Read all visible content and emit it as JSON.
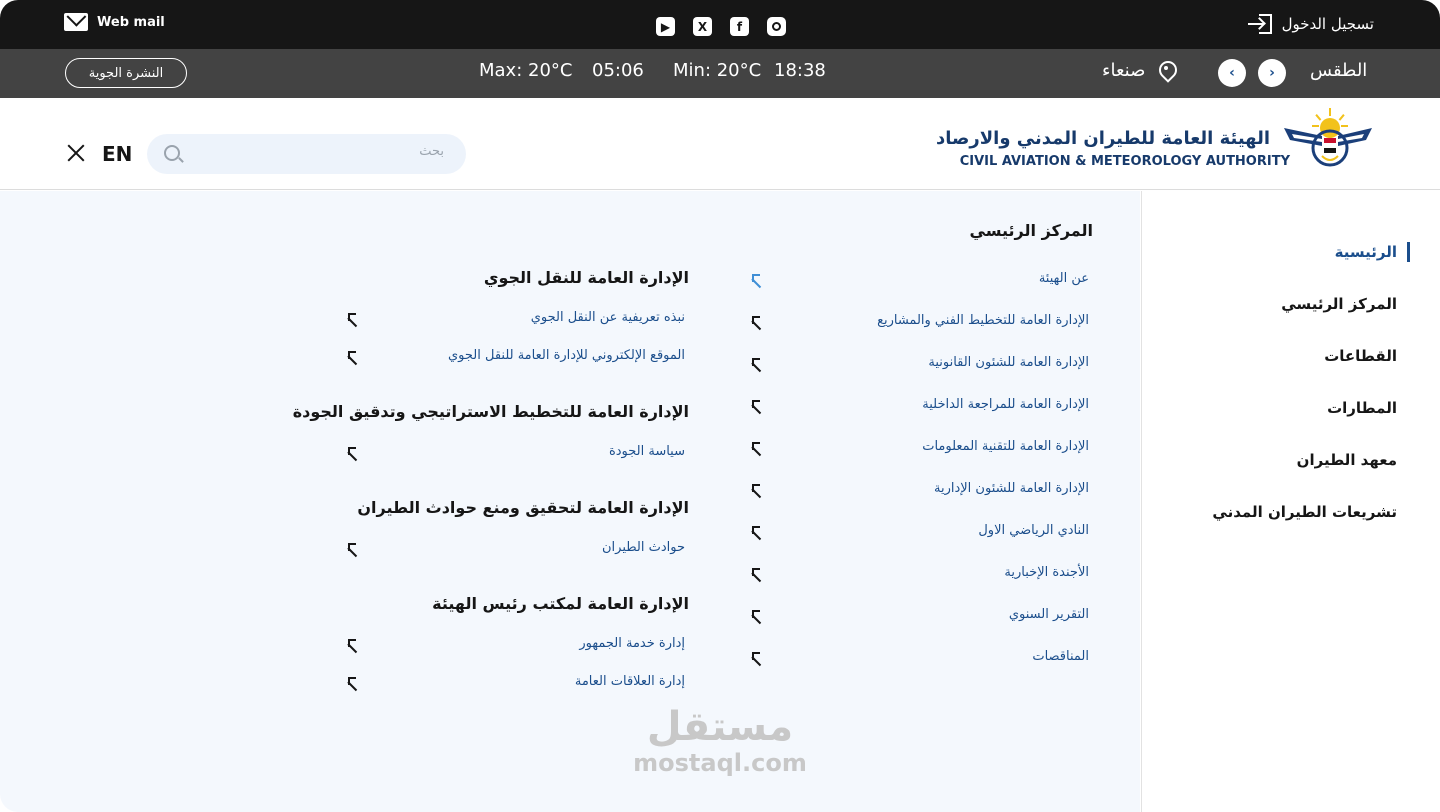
{
  "topbar": {
    "webmail_label": "Web mail",
    "socials": [
      "youtube-icon",
      "x-icon",
      "facebook-icon",
      "instagram-icon"
    ],
    "login_label": "تسجيل الدخول"
  },
  "weather": {
    "bulletin_button": "النشرة الجوية",
    "max": "Max:  20°C",
    "time1": "05:06",
    "min": "Min: 20°C",
    "time2": "18:38",
    "city": "صنعاء",
    "label": "الطقس"
  },
  "header": {
    "logo_ar": "الهيئة العامة للطيران المدني والارصاد",
    "logo_en": "CIVIL AVIATION & METEOROLOGY AUTHORITY",
    "search_placeholder": "بحث",
    "lang": "EN"
  },
  "sidebar": {
    "items": [
      {
        "label": "الرئيسية",
        "active": true
      },
      {
        "label": "المركز الرئيسي"
      },
      {
        "label": "القطاعات"
      },
      {
        "label": "المطارات"
      },
      {
        "label": "معهد الطيران"
      },
      {
        "label": "تشريعات الطيران المدني"
      }
    ]
  },
  "menu": {
    "main_center_title": "المركز الرئيسي",
    "main_center_links": [
      "عن الهيئة",
      "الإدارة العامة للتخطيط الفني والمشاريع",
      "الإدارة العامة للشئون القانونية",
      "الإدارة العامة للمراجعة الداخلية",
      "الإدارة العامة للتقنية المعلومات",
      "الإدارة العامة للشئون الإدارية",
      "النادي الرياضي الاول",
      "الأجندة الإخبارية",
      "التقرير السنوي",
      "المناقصات"
    ],
    "groups": [
      {
        "title": "الإدارة العامة للنقل الجوي",
        "links": [
          "نبذه تعريفية عن النقل الجوي",
          "الموقع الإلكتروني للإدارة العامة للنقل الجوي"
        ]
      },
      {
        "title": "الإدارة العامة للتخطيط الاستراتيجي وتدقيق الجودة",
        "links": [
          "سياسة الجودة"
        ]
      },
      {
        "title": "الإدارة العامة لتحقيق ومنع حوادث الطيران",
        "links": [
          "حوادث الطيران"
        ]
      },
      {
        "title": "الإدارة العامة لمكتب رئيس الهيئة",
        "links": [
          "إدارة خدمة الجمهور",
          "إدارة العلاقات العامة"
        ]
      }
    ]
  },
  "watermark": {
    "ar": "مستقل",
    "en": "mostaql.com"
  }
}
